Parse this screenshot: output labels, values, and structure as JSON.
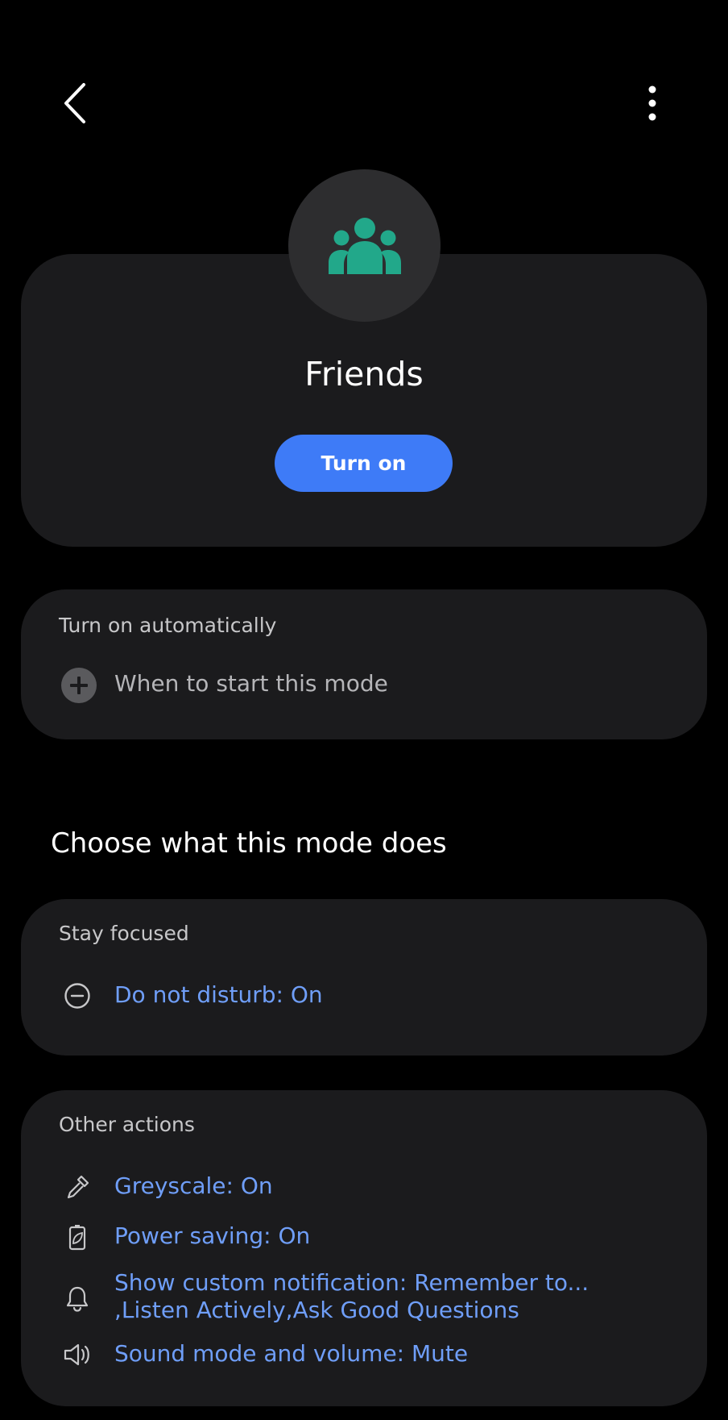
{
  "header": {
    "back_icon": "chevron-left-icon",
    "more_icon": "more-vertical-icon"
  },
  "mode": {
    "icon": "people-group-icon",
    "icon_color": "#22a88a",
    "title": "Friends",
    "turn_on_label": "Turn on",
    "accent_color": "#3e7bf7"
  },
  "automation": {
    "header": "Turn on automatically",
    "add_icon": "plus-circle-icon",
    "add_label": "When to start this mode"
  },
  "section_title": "Choose what this mode does",
  "stay_focused": {
    "header": "Stay focused",
    "items": [
      {
        "icon": "minus-circle-icon",
        "label": "Do not disturb: On"
      }
    ]
  },
  "other_actions": {
    "header": "Other actions",
    "items": [
      {
        "icon": "eyedropper-icon",
        "label": "Greyscale: On"
      },
      {
        "icon": "battery-leaf-icon",
        "label": "Power saving: On"
      },
      {
        "icon": "bell-icon",
        "label": "Show custom notification: Remember to... ,Listen Actively,Ask Good Questions"
      },
      {
        "icon": "speaker-icon",
        "label": "Sound mode and volume: Mute"
      }
    ]
  },
  "link_color": "#6f9ef8"
}
